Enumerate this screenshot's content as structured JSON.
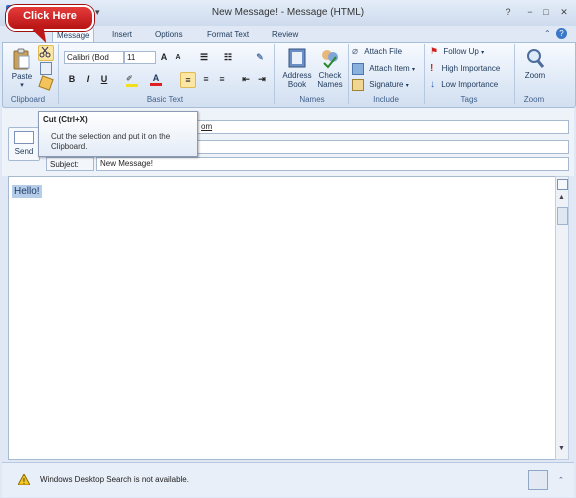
{
  "window": {
    "title": "New Message!  -  Message (HTML)",
    "controls": [
      "?",
      "−",
      "□",
      "✕"
    ]
  },
  "callout": {
    "label": "Click Here"
  },
  "tabs": [
    "Message",
    "Insert",
    "Options",
    "Format Text",
    "Review"
  ],
  "ribbon": {
    "clipboard": {
      "paste_label": "Paste",
      "group_label": "Clipboard"
    },
    "basic_text": {
      "font": "Calibri (Bod",
      "size": "11",
      "group_label": "Basic Text"
    },
    "names": {
      "address_book": [
        "Address",
        "Book"
      ],
      "check_names": [
        "Check",
        "Names"
      ],
      "group_label": "Names"
    },
    "include": {
      "attach_file": "Attach File",
      "attach_item": "Attach Item",
      "signature": "Signature",
      "group_label": "Include"
    },
    "tags": {
      "follow_up": "Follow Up",
      "high_importance": "High Importance",
      "low_importance": "Low Importance",
      "group_label": "Tags"
    },
    "zoom": {
      "zoom_label": "Zoom",
      "group_label": "Zoom"
    }
  },
  "tooltip": {
    "title": "Cut (Ctrl+X)",
    "description": "Cut the selection and put it on the Clipboard."
  },
  "header": {
    "send_label": "Send",
    "to_value": "om",
    "subject_label": "Subject:",
    "subject_value": "New Message!"
  },
  "body": {
    "text": "Hello!"
  },
  "status": {
    "message": "Windows Desktop Search is not available."
  }
}
